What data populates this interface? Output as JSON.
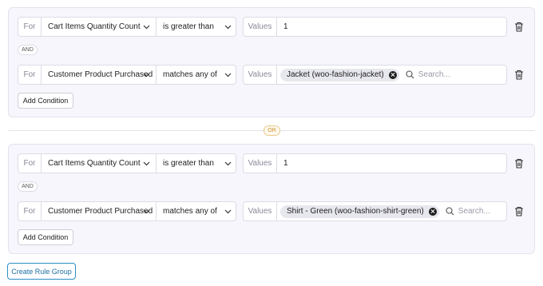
{
  "rule_groups": [
    {
      "conditions": [
        {
          "for_label": "For",
          "field": "Cart Items Quantity Count",
          "operator": "is greater than",
          "values_label": "Values",
          "value": "1"
        },
        {
          "for_label": "For",
          "field": "Customer Product Purchased",
          "operator": "matches any of",
          "values_label": "Values",
          "tag": "Jacket (woo-fashion-jacket)",
          "search_placeholder": "Search..."
        }
      ],
      "and_label": "AND",
      "add_condition_label": "Add Condition"
    },
    {
      "conditions": [
        {
          "for_label": "For",
          "field": "Cart Items Quantity Count",
          "operator": "is greater than",
          "values_label": "Values",
          "value": "1"
        },
        {
          "for_label": "For",
          "field": "Customer Product Purchased",
          "operator": "matches any of",
          "values_label": "Values",
          "tag": "Shirt - Green (woo-fashion-shirt-green)",
          "search_placeholder": "Search..."
        }
      ],
      "and_label": "AND",
      "add_condition_label": "Add Condition"
    }
  ],
  "or_label": "OR",
  "create_rule_group_label": "Create Rule Group",
  "icons": {
    "dropdown": "chevron-down-icon",
    "delete": "trash-icon",
    "remove_tag": "close-circle-icon",
    "search": "search-icon"
  },
  "colors": {
    "group_bg": "#f6f6fc",
    "or_accent": "#c9902a",
    "primary": "#1d6fa5"
  }
}
